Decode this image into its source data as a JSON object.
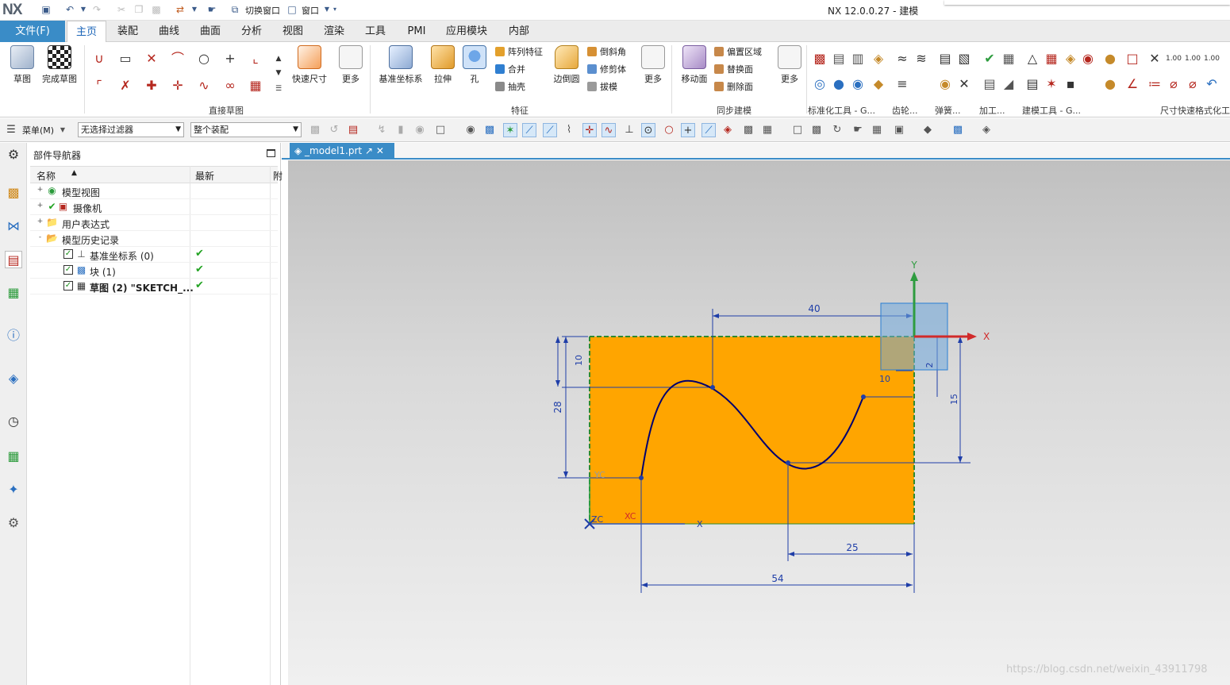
{
  "title_bar": {
    "logo": "NX",
    "switch_window": "切换窗口",
    "window": "窗口",
    "app_title": "NX 12.0.0.27 - 建模"
  },
  "menu": {
    "file": "文件(F)",
    "tabs": [
      "主页",
      "装配",
      "曲线",
      "曲面",
      "分析",
      "视图",
      "渲染",
      "工具",
      "PMI",
      "应用模块",
      "内部"
    ]
  },
  "ribbon": {
    "sketch": "草图",
    "finish_sketch": "完成草图",
    "rapid_dimension": "快速尺寸",
    "more": "更多",
    "datum_csys": "基准坐标系",
    "extrude": "拉伸",
    "hole": "孔",
    "pattern_feature": "阵列特征",
    "unite": "合并",
    "shell": "抽壳",
    "edge_blend": "边倒圆",
    "chamfer": "倒斜角",
    "trim_body": "修剪体",
    "draft": "拔模",
    "move_face": "移动面",
    "offset_region": "偏置区域",
    "replace_face": "替换面",
    "delete_face": "删除面",
    "groups": {
      "direct_sketch": "直接草图",
      "feature": "特征",
      "sync_modeling": "同步建模",
      "std_tools": "标准化工具 - G...",
      "gear": "齿轮...",
      "spring": "弹簧...",
      "machining": "加工...",
      "build_tools": "建模工具 - G...",
      "dim_format": "尺寸快速格式化工"
    }
  },
  "selection_bar": {
    "menu": "菜单(M)",
    "filter": "无选择过滤器",
    "scope": "整个装配"
  },
  "navigator": {
    "title": "部件导航器",
    "col_name": "名称",
    "col_latest": "最新",
    "col_extra": "附",
    "rows": [
      {
        "label": "模型视图",
        "indent": 0,
        "expander": "+"
      },
      {
        "label": "摄像机",
        "indent": 0,
        "expander": "+"
      },
      {
        "label": "用户表达式",
        "indent": 0,
        "expander": "+"
      },
      {
        "label": "模型历史记录",
        "indent": 0,
        "expander": "-"
      },
      {
        "label": "基准坐标系 (0)",
        "indent": 1,
        "checked": true,
        "latest": true
      },
      {
        "label": "块 (1)",
        "indent": 1,
        "checked": true,
        "latest": true
      },
      {
        "label": "草图 (2) \"SKETCH_...",
        "indent": 1,
        "checked": true,
        "latest": true,
        "bold": true
      }
    ]
  },
  "view_tab": {
    "label": "_model1.prt"
  },
  "cad": {
    "axis_labels": {
      "y": "Y",
      "x": "X",
      "yc": "YC",
      "xc": "XC",
      "zc": "ZC",
      "x2": "X"
    },
    "dimensions": {
      "d40": "40",
      "d10a": "10",
      "d28": "28",
      "d10b": "10",
      "d2": "2",
      "d15": "15",
      "d25": "25",
      "d54": "54"
    }
  },
  "watermark": "https://blog.csdn.net/weixin_43911798",
  "colors": {
    "accent": "#3a8cc7",
    "block": "#ffa500",
    "dimension": "#1f3ea8",
    "spline": "#00006e"
  }
}
